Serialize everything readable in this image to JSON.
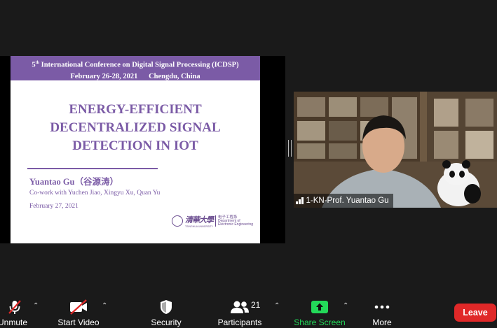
{
  "slide": {
    "conf_num": "5",
    "conf_sup": "th",
    "conf_name": " International Conference on Digital Signal Processing (ICDSP)",
    "conf_date": "February 26-28, 2021      Chengdu, China",
    "title_lines": [
      "ENERGY-EFFICIENT",
      "DECENTRALIZED SIGNAL",
      "DETECTION IN IOT"
    ],
    "author": "Yuantao Gu（谷源涛）",
    "cowork": "Co-work with Yuchen Jiao, Xingyu Xu, Quan Yu",
    "date": "February 27, 2021",
    "logo_cn": "清華大學",
    "logo_en": "TSINGHUA UNIVERSITY",
    "dept_cn": "电子工程系",
    "dept_en_1": "Department of",
    "dept_en_2": "Electronic Engineering",
    "accent": "#7b5ba6"
  },
  "video": {
    "participant_name": "1-KN-Prof. Yuantao Gu"
  },
  "toolbar": {
    "unmute": "Unmute",
    "start_video": "Start Video",
    "security": "Security",
    "participants": "Participants",
    "participant_count": "21",
    "share_screen": "Share Screen",
    "more": "More",
    "leave": "Leave",
    "share_color": "#23d959",
    "leave_color": "#e02828"
  }
}
